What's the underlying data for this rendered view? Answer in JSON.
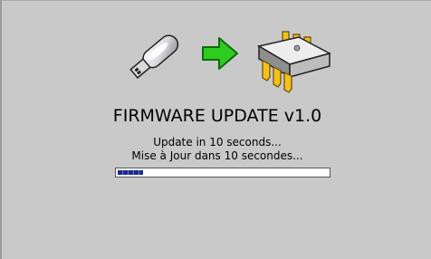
{
  "title": "FIRMWARE UPDATE v1.0",
  "message_en": "Update in 10 seconds...",
  "message_fr": "Mise à Jour dans 10 secondes...",
  "progress_fraction": 0.12,
  "icons": [
    "usb-stick-icon",
    "arrow-right-icon",
    "chip-icon"
  ],
  "colors": {
    "background": "#c9c9c9",
    "arrow": "#2ecc1f",
    "progress_fill": "#1d2c8c",
    "chip_pins": "#f2c21c"
  }
}
